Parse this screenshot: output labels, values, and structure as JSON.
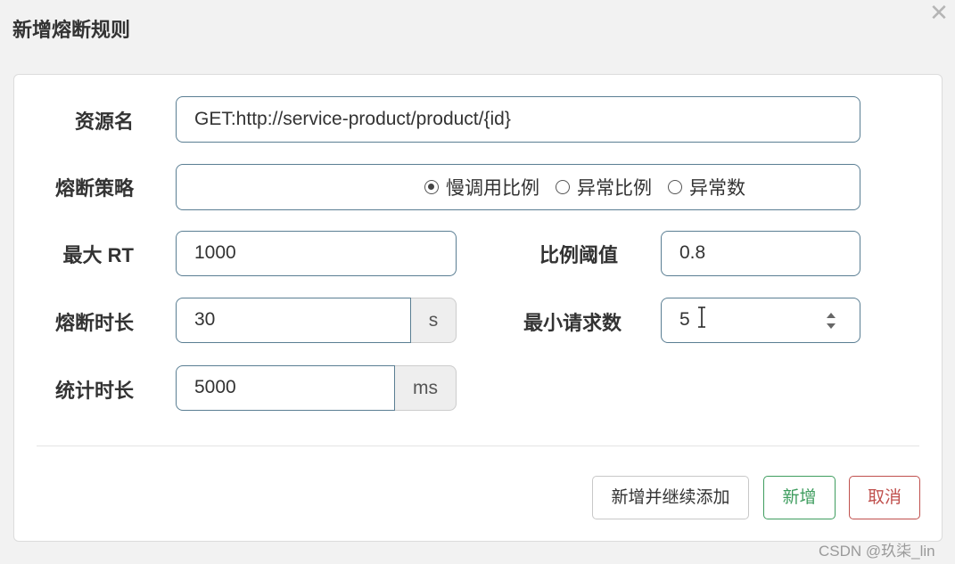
{
  "dialog": {
    "title": "新增熔断规则",
    "close_icon": "close-icon"
  },
  "form": {
    "resource": {
      "label": "资源名",
      "value": "GET:http://service-product/product/{id}"
    },
    "strategy": {
      "label": "熔断策略",
      "options": [
        {
          "label": "慢调用比例",
          "checked": true
        },
        {
          "label": "异常比例",
          "checked": false
        },
        {
          "label": "异常数",
          "checked": false
        }
      ]
    },
    "max_rt": {
      "label": "最大 RT",
      "value": "1000"
    },
    "ratio_threshold": {
      "label": "比例阈值",
      "value": "0.8"
    },
    "break_duration": {
      "label": "熔断时长",
      "value": "30",
      "unit": "s"
    },
    "min_requests": {
      "label": "最小请求数",
      "value": "5"
    },
    "stat_duration": {
      "label": "统计时长",
      "value": "5000",
      "unit": "ms"
    }
  },
  "buttons": {
    "add_continue": "新增并继续添加",
    "add": "新增",
    "cancel": "取消"
  },
  "watermark": "CSDN @玖柒_lin",
  "colors": {
    "input_border": "#5a7e93",
    "add_green": "#3f9d5f",
    "cancel_red": "#c0504d"
  }
}
